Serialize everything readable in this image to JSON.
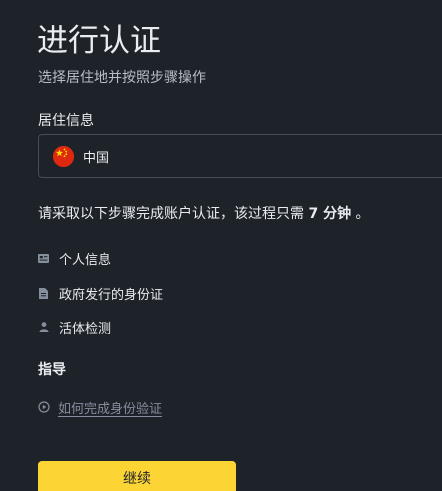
{
  "header": {
    "title": "进行认证",
    "subtitle": "选择居住地并按照步骤操作"
  },
  "residence": {
    "label": "居住信息",
    "selected_country": "中国",
    "flag_icon": "china-flag-icon"
  },
  "intro": {
    "text_before": "请采取以下步骤完成账户认证，该过程只需 ",
    "duration": "7 分钟",
    "text_after": " 。"
  },
  "steps": [
    {
      "label": "个人信息",
      "icon": "id-card-icon"
    },
    {
      "label": "政府发行的身份证",
      "icon": "document-icon"
    },
    {
      "label": "活体检测",
      "icon": "person-icon"
    }
  ],
  "guide": {
    "title": "指导",
    "link_label": "如何完成身份验证",
    "link_icon": "play-circle-icon"
  },
  "actions": {
    "continue_label": "继续"
  },
  "colors": {
    "background": "#1e2329",
    "accent": "#fcd535",
    "text": "#eaecef",
    "muted": "#848e9c",
    "border": "#474d57"
  }
}
